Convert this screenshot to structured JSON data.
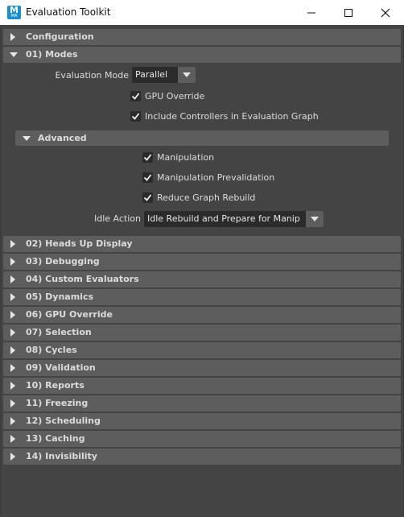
{
  "window": {
    "title": "Evaluation Toolkit",
    "icon_letter": "M",
    "icon_sub": "MA",
    "buttons": [
      "minimize-icon",
      "maximize-icon",
      "close-icon"
    ]
  },
  "sections_top": [
    {
      "label": "Configuration",
      "expanded": false
    },
    {
      "label": "01) Modes",
      "expanded": true
    }
  ],
  "modes": {
    "evaluation_mode_label": "Evaluation Mode",
    "evaluation_mode_value": "Parallel",
    "gpu_override_label": "GPU Override",
    "gpu_override_checked": true,
    "include_controllers_label": "Include Controllers in Evaluation Graph",
    "include_controllers_checked": true,
    "advanced": {
      "label": "Advanced",
      "expanded": true,
      "manipulation_label": "Manipulation",
      "manipulation_prevalidation_label": "Manipulation Prevalidation",
      "reduce_graph_rebuild_label": "Reduce Graph Rebuild",
      "idle_action_label": "Idle Action",
      "idle_action_value": "Idle Rebuild and Prepare for Manip"
    }
  },
  "sections": [
    "02) Heads Up Display",
    "03) Debugging",
    "04) Custom Evaluators",
    "05) Dynamics",
    "06) GPU Override",
    "07) Selection",
    "08) Cycles",
    "09) Validation",
    "10) Reports",
    "11) Freezing",
    "12) Scheduling",
    "13) Caching",
    "14) Invisibility"
  ],
  "colors": {
    "background": "#444444",
    "section_bar": "#5d5d5d",
    "field_bg": "#2b2b2b",
    "text": "#dcdcdc",
    "icon_blue": "#1b8fc9"
  }
}
